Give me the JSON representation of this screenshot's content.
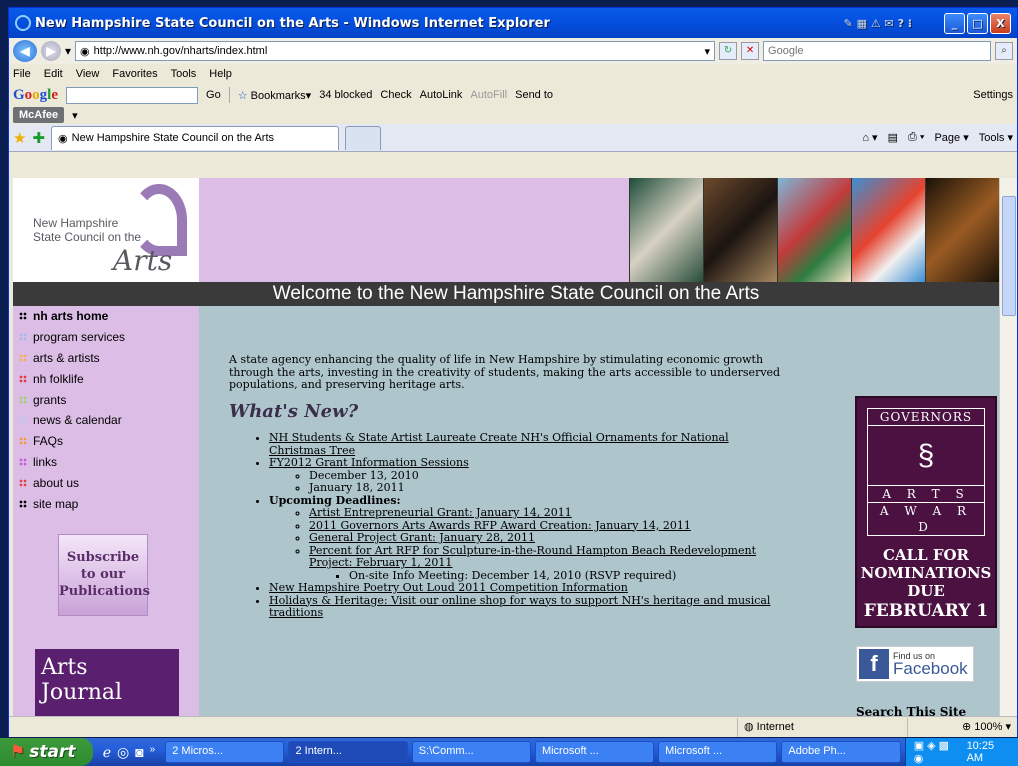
{
  "window": {
    "title": "New Hampshire State Council on the Arts - Windows Internet Explorer",
    "min": "_",
    "max": "□",
    "close": "X"
  },
  "address": {
    "url": "http://www.nh.gov/nharts/index.html",
    "search_placeholder": "Google"
  },
  "menu": [
    "File",
    "Edit",
    "View",
    "Favorites",
    "Tools",
    "Help"
  ],
  "google_toolbar": {
    "logo": "Google",
    "go": "Go",
    "bookmarks": "Bookmarks",
    "blocked": "34 blocked",
    "check": "Check",
    "autolink": "AutoLink",
    "autofill": "AutoFill",
    "sendto": "Send to",
    "settings": "Settings"
  },
  "mcafee": {
    "label": "McAfee"
  },
  "tabs": {
    "active": "New Hampshire State Council on the Arts",
    "page": "Page",
    "tools": "Tools"
  },
  "header": {
    "logo_line1": "New Hampshire",
    "logo_line2": "State Council on the",
    "logo_arts": "Arts",
    "welcome": "Welcome to the New Hampshire State Council on the Arts"
  },
  "nav": [
    {
      "label": "nh arts home",
      "color": "#000000"
    },
    {
      "label": "program services",
      "color": "#a7b6e8"
    },
    {
      "label": "arts & artists",
      "color": "#f3b34d"
    },
    {
      "label": "nh folklife",
      "color": "#e63b3b"
    },
    {
      "label": "grants",
      "color": "#9ed36b"
    },
    {
      "label": "news & calendar",
      "color": "#c0c8f0"
    },
    {
      "label": "FAQs",
      "color": "#f29b3a"
    },
    {
      "label": "links",
      "color": "#c85ad8"
    },
    {
      "label": "about us",
      "color": "#e14444"
    },
    {
      "label": "site map",
      "color": "#000000"
    }
  ],
  "subscribe": {
    "line1": "Subscribe",
    "line2": "to our",
    "line3": "Publications"
  },
  "journal": {
    "title": "Arts Journal"
  },
  "main": {
    "intro": "A state agency enhancing the quality of life in New Hampshire by stimulating economic growth through the arts, investing in the creativity of students, making the arts accessible to underserved populations, and preserving heritage arts.",
    "whats_new": "What's New?",
    "item1": "NH Students & State Artist Laureate Create NH's Official Ornaments for National Christmas Tree",
    "item2": "FY2012 Grant Information Sessions",
    "item2_sub1": "December 13, 2010",
    "item2_sub2": "January 18, 2011",
    "item3": "Upcoming Deadlines:",
    "item3_sub1": "Artist Entrepreneurial Grant: January 14, 2011",
    "item3_sub2": "2011 Governors Arts Awards RFP Award Creation: January 14, 2011",
    "item3_sub3": "General Project Grant: January 28, 2011",
    "item3_sub4": "Percent for Art RFP for Sculpture-in-the-Round Hampton Beach Redevelopment Project: February 1, 2011",
    "item3_sub4_sub1": "On-site Info Meeting: December 14, 2010 (RSVP required)",
    "item4": "New Hampshire Poetry Out Loud 2011 Competition Information",
    "item5": "Holidays & Heritage: Visit our online shop for ways to support NH's heritage and musical traditions"
  },
  "governors": {
    "top": "GOVERNORS",
    "row1": "A R T S",
    "row2": "A W A R D",
    "cta1": "CALL FOR",
    "cta2": "NOMINATIONS",
    "cta3": "DUE",
    "cta4": "FEBRUARY 1"
  },
  "facebook": {
    "find": "Find us on",
    "name": "Facebook"
  },
  "search_site": "Search This Site",
  "status": {
    "zone": "Internet",
    "zoom": "100%"
  },
  "taskbar": {
    "start": "start",
    "items": [
      "2 Micros...",
      "2 Intern...",
      "S:\\Comm...",
      "Microsoft ...",
      "Microsoft ...",
      "Adobe Ph..."
    ],
    "clock": "10:25 AM"
  }
}
